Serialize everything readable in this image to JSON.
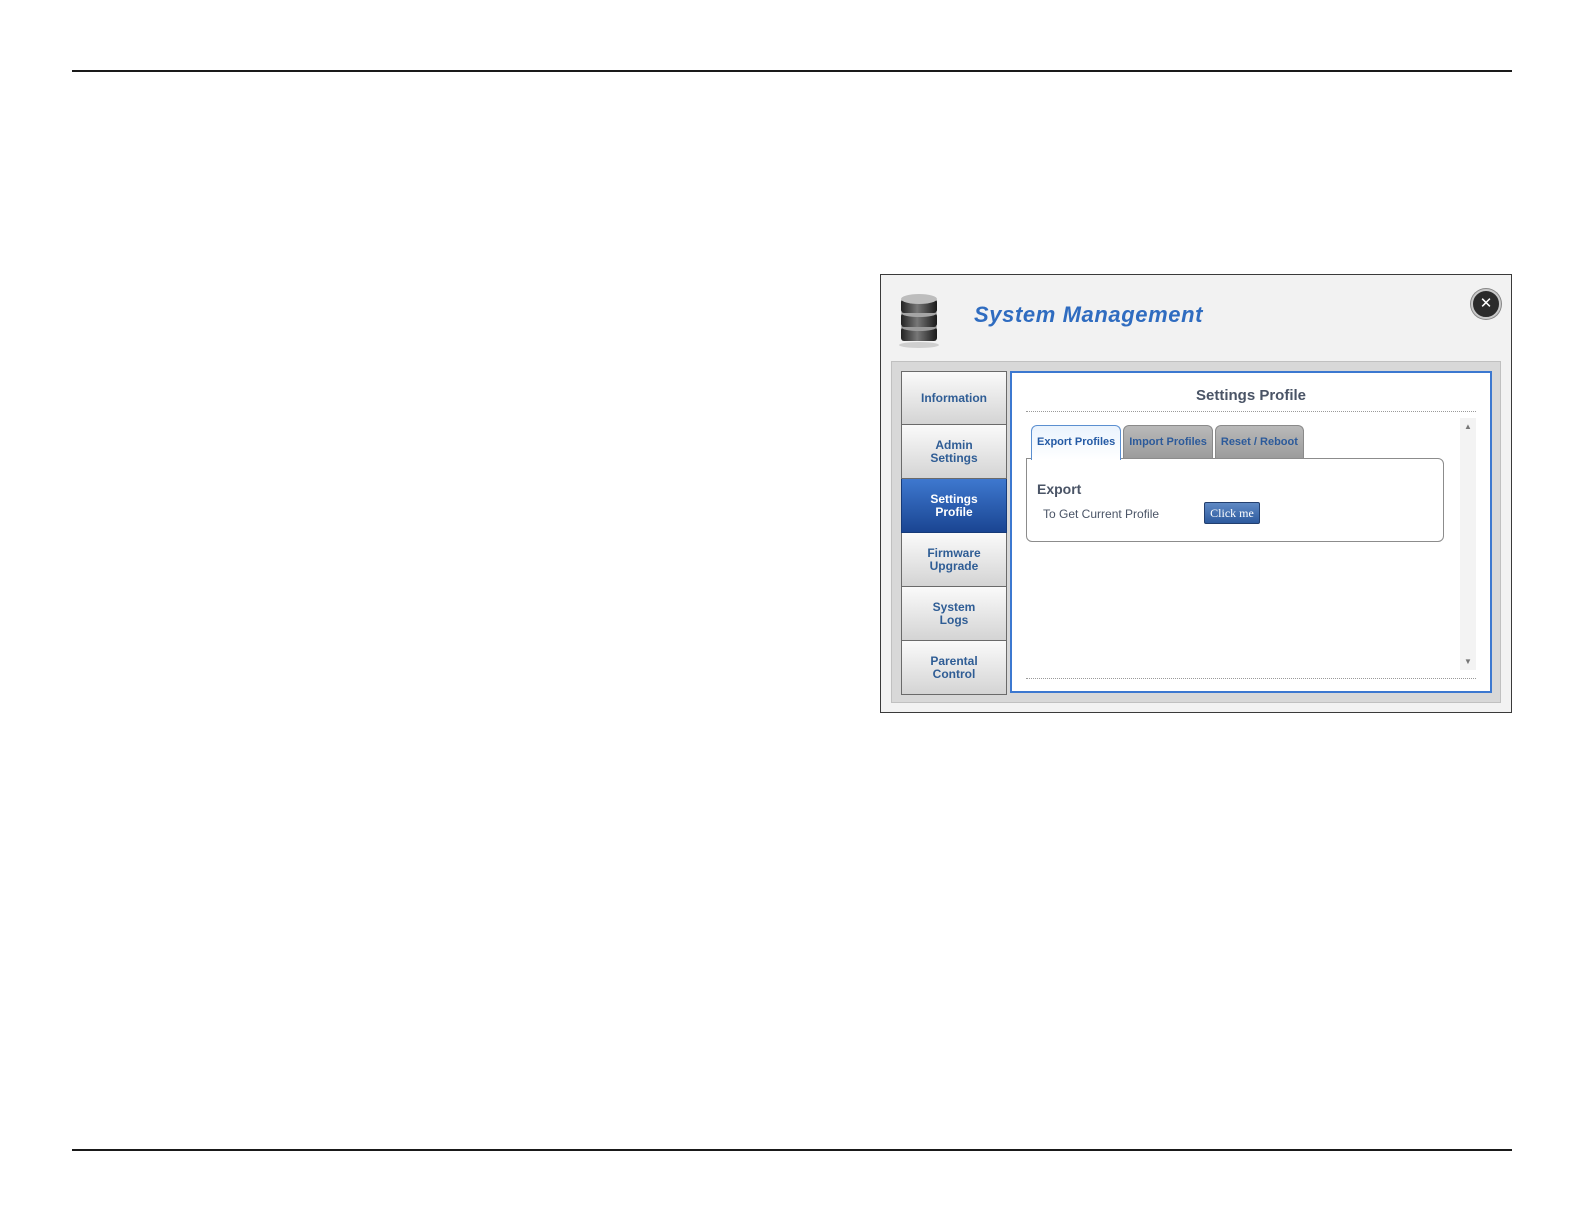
{
  "window": {
    "title": "System Management",
    "close_label": "✕"
  },
  "nav": {
    "items": [
      {
        "label": "Information",
        "active": false
      },
      {
        "label": "Admin\nSettings",
        "active": false
      },
      {
        "label": "Settings\nProfile",
        "active": true
      },
      {
        "label": "Firmware\nUpgrade",
        "active": false
      },
      {
        "label": "System\nLogs",
        "active": false
      },
      {
        "label": "Parental\nControl",
        "active": false
      }
    ]
  },
  "panel": {
    "title": "Settings Profile",
    "tabs": [
      {
        "label": "Export Profiles",
        "active": true
      },
      {
        "label": "Import Profiles",
        "active": false
      },
      {
        "label": "Reset / Reboot",
        "active": false
      }
    ],
    "export": {
      "section_title": "Export",
      "field_label": "To Get Current Profile",
      "button_label": "Click me"
    }
  },
  "scrollbar": {
    "up_icon": "▲",
    "down_icon": "▼"
  },
  "colors": {
    "accent": "#2f6cc0",
    "active_nav": "#1a4592",
    "panel_border": "#3c78d0"
  }
}
